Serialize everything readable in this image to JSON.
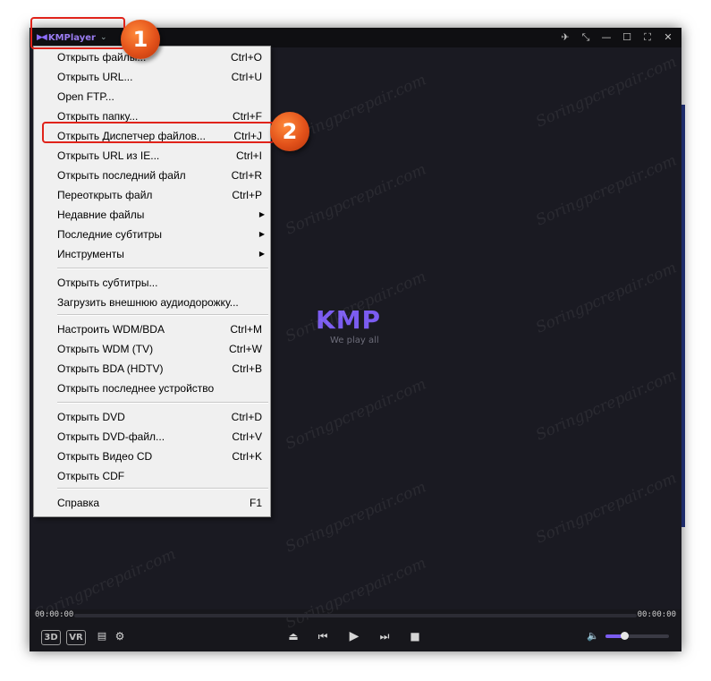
{
  "titlebar": {
    "brand": "KMPlayer",
    "icons": [
      "pin-icon",
      "compact-mode-icon",
      "minimize-icon",
      "maximize-icon",
      "fullscreen-icon",
      "close-icon"
    ]
  },
  "video": {
    "logo_text": "KMP",
    "tagline": "We play all",
    "watermark": "Soringpcrepair.com"
  },
  "menu": {
    "items": [
      {
        "label": "Открыть файлы...",
        "shortcut": "Ctrl+O"
      },
      {
        "label": "Открыть URL...",
        "shortcut": "Ctrl+U"
      },
      {
        "label": "Open FTP...",
        "shortcut": ""
      },
      {
        "label": "Открыть папку...",
        "shortcut": "Ctrl+F"
      },
      {
        "label": "Открыть Диспетчер файлов...",
        "shortcut": "Ctrl+J"
      },
      {
        "label": "Открыть URL из IE...",
        "shortcut": "Ctrl+I"
      },
      {
        "label": "Открыть последний файл",
        "shortcut": "Ctrl+R"
      },
      {
        "label": "Переоткрыть файл",
        "shortcut": "Ctrl+P"
      },
      {
        "label": "Недавние файлы",
        "shortcut": "",
        "submenu": true
      },
      {
        "label": "Последние субтитры",
        "shortcut": "",
        "submenu": true
      },
      {
        "label": "Инструменты",
        "shortcut": "",
        "submenu": true
      },
      {
        "label": "Открыть субтитры...",
        "shortcut": ""
      },
      {
        "label": "Загрузить внешнюю аудиодорожку...",
        "shortcut": ""
      },
      {
        "label": "Настроить WDM/BDA",
        "shortcut": "Ctrl+M"
      },
      {
        "label": "Открыть WDM (TV)",
        "shortcut": "Ctrl+W"
      },
      {
        "label": "Открыть BDA (HDTV)",
        "shortcut": "Ctrl+B"
      },
      {
        "label": "Открыть последнее устройство",
        "shortcut": ""
      },
      {
        "label": "Открыть DVD",
        "shortcut": "Ctrl+D"
      },
      {
        "label": "Открыть DVD-файл...",
        "shortcut": "Ctrl+V"
      },
      {
        "label": "Открыть Видео CD",
        "shortcut": "Ctrl+K"
      },
      {
        "label": "Открыть CDF",
        "shortcut": ""
      },
      {
        "label": "Справка",
        "shortcut": "F1"
      }
    ]
  },
  "playback": {
    "time_current": "00:00:00",
    "time_total": "00:00:00",
    "badge_3d": "3D",
    "badge_vr": "VR",
    "volume_level": 0.3,
    "icons": [
      "playlist-icon",
      "settings-icon",
      "eject-icon",
      "previous-icon",
      "play-icon",
      "next-icon",
      "stop-icon",
      "volume-icon"
    ]
  },
  "annotations": {
    "marker_1": "1",
    "marker_2": "2",
    "highlight_color": "#e0231a",
    "marker_color": "#e2511a"
  },
  "colors": {
    "accent": "#7b5cf0",
    "window_bg": "#17171c",
    "menu_bg": "#f0f0f0"
  }
}
